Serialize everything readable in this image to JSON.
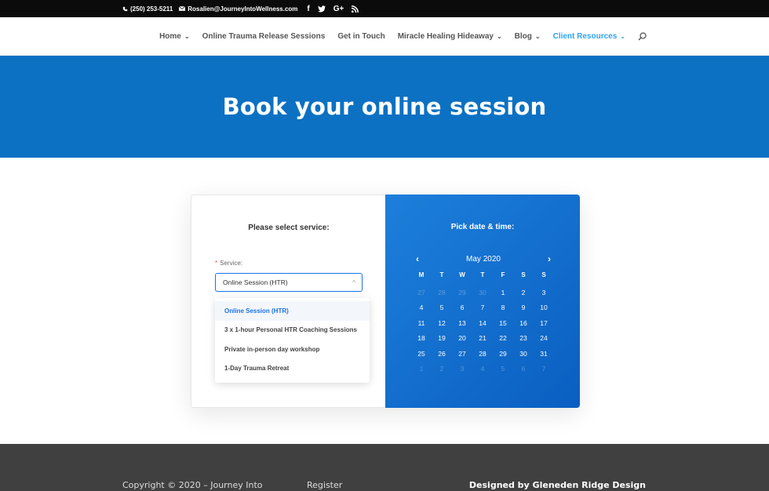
{
  "topbar": {
    "phone": "(250) 253-5211",
    "email": "Rosalien@JourneyIntoWellness.com",
    "social_icons": [
      "facebook-icon",
      "twitter-icon",
      "google-plus-icon",
      "rss-icon"
    ],
    "gplus_label": "G+",
    "facebook_glyph": "f"
  },
  "nav": {
    "items": [
      {
        "label": "Home",
        "has_dropdown": true
      },
      {
        "label": "Online Trauma Release Sessions",
        "has_dropdown": false
      },
      {
        "label": "Get in Touch",
        "has_dropdown": false
      },
      {
        "label": "Miracle Healing Hideaway",
        "has_dropdown": true
      },
      {
        "label": "Blog",
        "has_dropdown": true
      },
      {
        "label": "Client Resources",
        "has_dropdown": true,
        "active": true
      }
    ],
    "chevron": "⌄"
  },
  "hero": {
    "title": "Book your online session"
  },
  "booking": {
    "service_panel": {
      "title": "Please select service:",
      "field_required_mark": "*",
      "field_label": "Service:",
      "selected_value": "Online Session (HTR)",
      "caret": "^",
      "options": [
        "Online Session (HTR)",
        "3 x 1-hour Personal HTR Coaching Sessions",
        "Private in-person day workshop",
        "1-Day Trauma Retreat"
      ]
    },
    "calendar": {
      "title": "Pick date & time:",
      "month": "May 2020",
      "prev": "‹",
      "next": "›",
      "weekdays": [
        "M",
        "T",
        "W",
        "T",
        "F",
        "S",
        "S"
      ],
      "days": [
        [
          "27",
          "28",
          "29",
          "30",
          "1",
          "2",
          "3"
        ],
        [
          "4",
          "5",
          "6",
          "7",
          "8",
          "9",
          "10"
        ],
        [
          "11",
          "12",
          "13",
          "14",
          "15",
          "16",
          "17"
        ],
        [
          "18",
          "19",
          "20",
          "21",
          "22",
          "23",
          "24"
        ],
        [
          "25",
          "26",
          "27",
          "28",
          "29",
          "30",
          "31"
        ],
        [
          "1",
          "2",
          "3",
          "4",
          "5",
          "6",
          "7"
        ]
      ],
      "muted": [
        [
          0,
          0
        ],
        [
          0,
          1
        ],
        [
          0,
          2
        ],
        [
          0,
          3
        ],
        [
          5,
          0
        ],
        [
          5,
          1
        ],
        [
          5,
          2
        ],
        [
          5,
          3
        ],
        [
          5,
          4
        ],
        [
          5,
          5
        ],
        [
          5,
          6
        ]
      ]
    }
  },
  "footer": {
    "copyright": "Copyright © 2020 – Journey Into",
    "register": "Register",
    "designed_by": "Designed by Gleneden Ridge Design"
  },
  "colors": {
    "hero_bg": "#0c71c3",
    "calendar_bg": "#0a5fc1",
    "accent": "#1a73e8",
    "active_nav": "#2ea3f2",
    "footer_bg": "#404040"
  }
}
